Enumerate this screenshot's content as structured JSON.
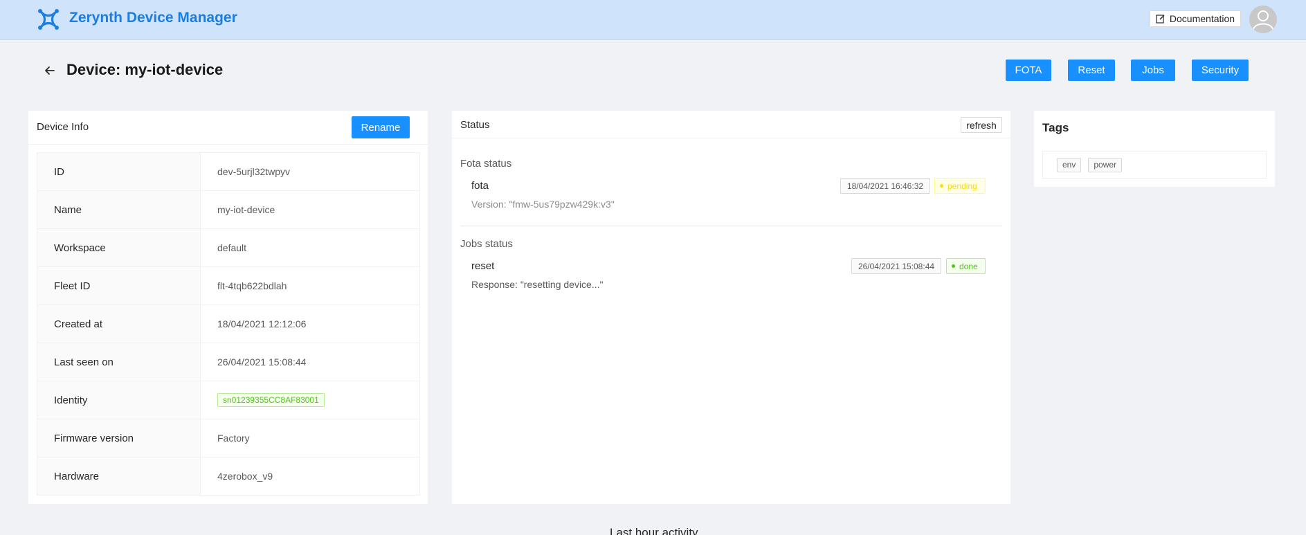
{
  "header": {
    "brand": "Zerynth Device Manager",
    "documentation_label": "Documentation",
    "colors": {
      "topbar": "#cfe4fb",
      "brand": "#1c7ee0",
      "primary": "#1890ff"
    }
  },
  "page": {
    "title": "Device: my-iot-device",
    "actions": {
      "fota": "FOTA",
      "reset": "Reset",
      "jobs": "Jobs",
      "security": "Security"
    }
  },
  "device_info": {
    "title": "Device Info",
    "rename_label": "Rename",
    "rows": [
      {
        "label": "ID",
        "value": "dev-5urjl32twpyv"
      },
      {
        "label": "Name",
        "value": "my-iot-device"
      },
      {
        "label": "Workspace",
        "value": "default"
      },
      {
        "label": "Fleet ID",
        "value": "flt-4tqb622bdlah"
      },
      {
        "label": "Created at",
        "value": "18/04/2021 12:12:06"
      },
      {
        "label": "Last seen on",
        "value": "26/04/2021 15:08:44"
      },
      {
        "label": "Identity",
        "value": "sn01239355CC8AF83001"
      },
      {
        "label": "Firmware version",
        "value": "Factory"
      },
      {
        "label": "Hardware",
        "value": "4zerobox_v9"
      }
    ]
  },
  "status": {
    "title": "Status",
    "refresh_label": "refresh",
    "fota": {
      "section_label": "Fota status",
      "name": "fota",
      "detail": "Version: \"fmw-5us79pzw429k:v3\"",
      "timestamp": "18/04/2021 16:46:32",
      "state": "pending",
      "state_color": "#fadb14"
    },
    "jobs": {
      "section_label": "Jobs status",
      "name": "reset",
      "detail": "Response: \"resetting device...\"",
      "timestamp": "26/04/2021 15:08:44",
      "state": "done",
      "state_color": "#52c41a"
    }
  },
  "tags": {
    "title": "Tags",
    "items": [
      "env",
      "power"
    ]
  },
  "activity": {
    "title": "Last hour activity"
  }
}
